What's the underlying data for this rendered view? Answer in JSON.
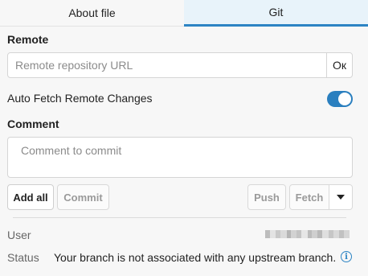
{
  "tabs": [
    {
      "label": "About file",
      "active": false
    },
    {
      "label": "Git",
      "active": true
    }
  ],
  "remote": {
    "label": "Remote",
    "placeholder": "Remote repository URL",
    "value": "",
    "ok_label": "Oк"
  },
  "auto_fetch": {
    "label": "Auto Fetch Remote Changes",
    "enabled": true
  },
  "comment": {
    "label": "Comment",
    "placeholder": "Comment to commit",
    "value": ""
  },
  "actions": {
    "add_all": "Add all",
    "commit": "Commit",
    "push": "Push",
    "fetch": "Fetch"
  },
  "info": {
    "user_label": "User",
    "status_label": "Status",
    "status_text": "Your branch is not associated with any upstream branch.",
    "info_icon": "info-circle-icon"
  },
  "colors": {
    "accent": "#2c84c4",
    "toggle_on": "#2a7fbf",
    "active_tab_bg": "#e8f3fa"
  }
}
